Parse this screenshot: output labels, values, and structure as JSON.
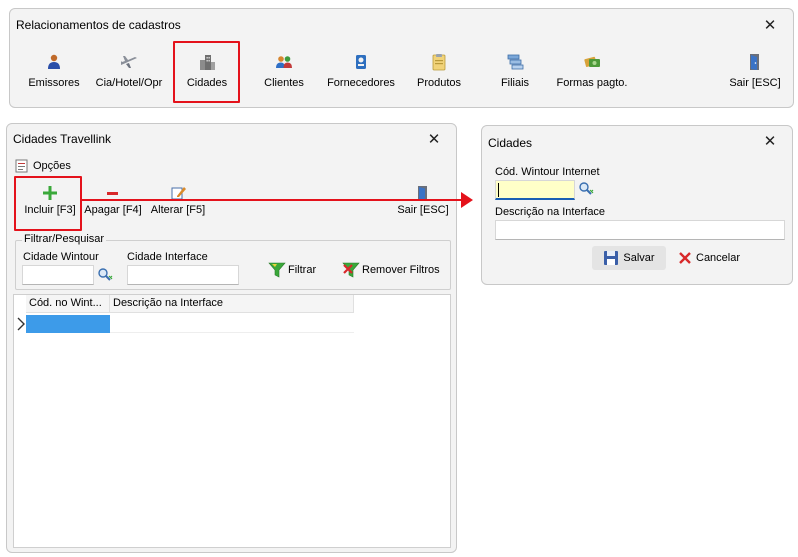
{
  "main_window": {
    "title": "Relacionamentos de cadastros",
    "close": "✕",
    "toolbar": [
      {
        "label": "Emissores",
        "icon": "users-icon"
      },
      {
        "label": "Cia/Hotel/Opr",
        "icon": "airplane-icon"
      },
      {
        "label": "Cidades",
        "icon": "buildings-icon"
      },
      {
        "label": "Clientes",
        "icon": "clients-icon"
      },
      {
        "label": "Fornecedores",
        "icon": "supplier-icon"
      },
      {
        "label": "Produtos",
        "icon": "products-icon"
      },
      {
        "label": "Filiais",
        "icon": "branches-icon"
      },
      {
        "label": "Formas pagto.",
        "icon": "payment-icon"
      },
      {
        "label": "Sair [ESC]",
        "icon": "exit-door-icon"
      }
    ]
  },
  "list_window": {
    "title": "Cidades Travellink",
    "close": "✕",
    "options_label": "Opções",
    "toolbar": {
      "include": "Incluir [F3]",
      "delete": "Apagar [F4]",
      "edit": "Alterar [F5]",
      "exit": "Sair [ESC]"
    },
    "filter": {
      "group_title": "Filtrar/Pesquisar",
      "city_wintour_label": "Cidade Wintour",
      "city_wintour_value": "",
      "city_interface_label": "Cidade Interface",
      "city_interface_value": "",
      "filter_button": "Filtrar",
      "remove_filters_button": "Remover Filtros"
    },
    "grid": {
      "columns": [
        "Cód. no Wint...",
        "Descrição na Interface"
      ],
      "rows": [
        [
          "",
          ""
        ]
      ]
    }
  },
  "form_window": {
    "title": "Cidades",
    "close": "✕",
    "code_label": "Cód. Wintour Internet",
    "code_value": "",
    "description_label": "Descrição na Interface",
    "description_value": "",
    "save_button": "Salvar",
    "cancel_button": "Cancelar"
  },
  "colors": {
    "highlight": "#e4121b",
    "selection": "#3d9be9",
    "required_field": "#ffffc8"
  }
}
